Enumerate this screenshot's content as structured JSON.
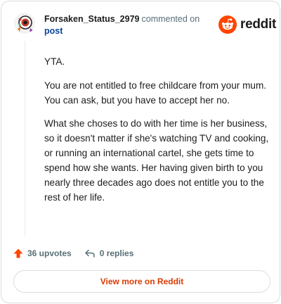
{
  "header": {
    "username": "Forsaken_Status_2979",
    "action_text": "commented on",
    "post_link": "post",
    "brand": "reddit"
  },
  "comment": {
    "paragraphs": [
      "YTA.",
      "You are not entitled to free childcare from your mum. You can ask, but you have to accept her no.",
      "What she choses to do with her time is her business, so it doesn't matter if she's watching TV and cooking, or running an international cartel, she gets time to spend how she wants. Her having given birth to you nearly three decades ago does not entitle you to the rest of her life."
    ]
  },
  "actions": {
    "upvotes": "36 upvotes",
    "replies": "0 replies"
  },
  "footer": {
    "view_more": "View more on Reddit"
  },
  "colors": {
    "brand_orange": "#ff4500",
    "link_blue": "#0a449b",
    "cta_orange": "#d93a00"
  },
  "icons": {
    "avatar": "user-avatar",
    "logo": "reddit-snoo-icon",
    "upvote": "upvote-arrow-icon",
    "reply": "reply-arrow-icon"
  }
}
